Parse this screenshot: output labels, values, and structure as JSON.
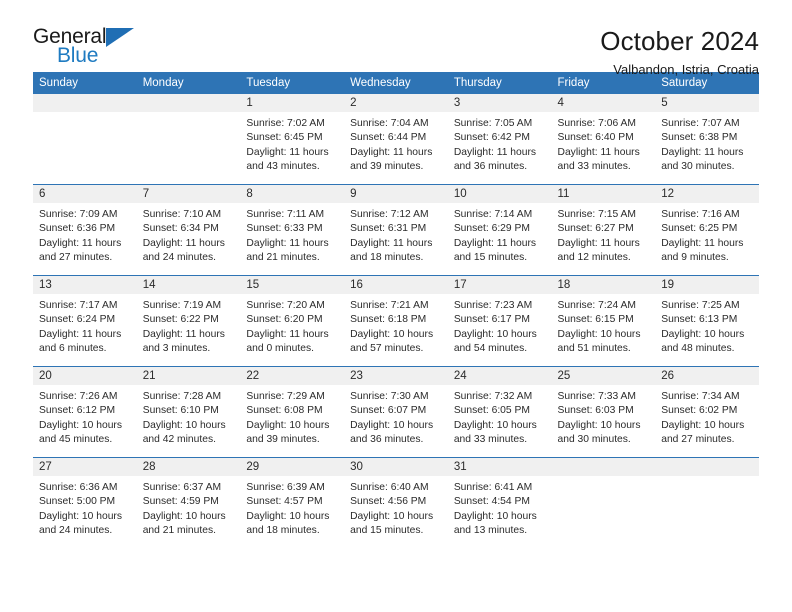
{
  "brand": {
    "name_part1": "General",
    "name_part2": "Blue",
    "accent_color": "#1f7bc1"
  },
  "header": {
    "title": "October 2024",
    "location": "Valbandon, Istria, Croatia"
  },
  "theme": {
    "header_blue": "#2e74b5",
    "band_gray": "#f0f0f0"
  },
  "weekdays": [
    "Sunday",
    "Monday",
    "Tuesday",
    "Wednesday",
    "Thursday",
    "Friday",
    "Saturday"
  ],
  "weeks": [
    [
      {
        "day": "",
        "lines": []
      },
      {
        "day": "",
        "lines": []
      },
      {
        "day": "1",
        "lines": [
          "Sunrise: 7:02 AM",
          "Sunset: 6:45 PM",
          "Daylight: 11 hours",
          "and 43 minutes."
        ]
      },
      {
        "day": "2",
        "lines": [
          "Sunrise: 7:04 AM",
          "Sunset: 6:44 PM",
          "Daylight: 11 hours",
          "and 39 minutes."
        ]
      },
      {
        "day": "3",
        "lines": [
          "Sunrise: 7:05 AM",
          "Sunset: 6:42 PM",
          "Daylight: 11 hours",
          "and 36 minutes."
        ]
      },
      {
        "day": "4",
        "lines": [
          "Sunrise: 7:06 AM",
          "Sunset: 6:40 PM",
          "Daylight: 11 hours",
          "and 33 minutes."
        ]
      },
      {
        "day": "5",
        "lines": [
          "Sunrise: 7:07 AM",
          "Sunset: 6:38 PM",
          "Daylight: 11 hours",
          "and 30 minutes."
        ]
      }
    ],
    [
      {
        "day": "6",
        "lines": [
          "Sunrise: 7:09 AM",
          "Sunset: 6:36 PM",
          "Daylight: 11 hours",
          "and 27 minutes."
        ]
      },
      {
        "day": "7",
        "lines": [
          "Sunrise: 7:10 AM",
          "Sunset: 6:34 PM",
          "Daylight: 11 hours",
          "and 24 minutes."
        ]
      },
      {
        "day": "8",
        "lines": [
          "Sunrise: 7:11 AM",
          "Sunset: 6:33 PM",
          "Daylight: 11 hours",
          "and 21 minutes."
        ]
      },
      {
        "day": "9",
        "lines": [
          "Sunrise: 7:12 AM",
          "Sunset: 6:31 PM",
          "Daylight: 11 hours",
          "and 18 minutes."
        ]
      },
      {
        "day": "10",
        "lines": [
          "Sunrise: 7:14 AM",
          "Sunset: 6:29 PM",
          "Daylight: 11 hours",
          "and 15 minutes."
        ]
      },
      {
        "day": "11",
        "lines": [
          "Sunrise: 7:15 AM",
          "Sunset: 6:27 PM",
          "Daylight: 11 hours",
          "and 12 minutes."
        ]
      },
      {
        "day": "12",
        "lines": [
          "Sunrise: 7:16 AM",
          "Sunset: 6:25 PM",
          "Daylight: 11 hours",
          "and 9 minutes."
        ]
      }
    ],
    [
      {
        "day": "13",
        "lines": [
          "Sunrise: 7:17 AM",
          "Sunset: 6:24 PM",
          "Daylight: 11 hours",
          "and 6 minutes."
        ]
      },
      {
        "day": "14",
        "lines": [
          "Sunrise: 7:19 AM",
          "Sunset: 6:22 PM",
          "Daylight: 11 hours",
          "and 3 minutes."
        ]
      },
      {
        "day": "15",
        "lines": [
          "Sunrise: 7:20 AM",
          "Sunset: 6:20 PM",
          "Daylight: 11 hours",
          "and 0 minutes."
        ]
      },
      {
        "day": "16",
        "lines": [
          "Sunrise: 7:21 AM",
          "Sunset: 6:18 PM",
          "Daylight: 10 hours",
          "and 57 minutes."
        ]
      },
      {
        "day": "17",
        "lines": [
          "Sunrise: 7:23 AM",
          "Sunset: 6:17 PM",
          "Daylight: 10 hours",
          "and 54 minutes."
        ]
      },
      {
        "day": "18",
        "lines": [
          "Sunrise: 7:24 AM",
          "Sunset: 6:15 PM",
          "Daylight: 10 hours",
          "and 51 minutes."
        ]
      },
      {
        "day": "19",
        "lines": [
          "Sunrise: 7:25 AM",
          "Sunset: 6:13 PM",
          "Daylight: 10 hours",
          "and 48 minutes."
        ]
      }
    ],
    [
      {
        "day": "20",
        "lines": [
          "Sunrise: 7:26 AM",
          "Sunset: 6:12 PM",
          "Daylight: 10 hours",
          "and 45 minutes."
        ]
      },
      {
        "day": "21",
        "lines": [
          "Sunrise: 7:28 AM",
          "Sunset: 6:10 PM",
          "Daylight: 10 hours",
          "and 42 minutes."
        ]
      },
      {
        "day": "22",
        "lines": [
          "Sunrise: 7:29 AM",
          "Sunset: 6:08 PM",
          "Daylight: 10 hours",
          "and 39 minutes."
        ]
      },
      {
        "day": "23",
        "lines": [
          "Sunrise: 7:30 AM",
          "Sunset: 6:07 PM",
          "Daylight: 10 hours",
          "and 36 minutes."
        ]
      },
      {
        "day": "24",
        "lines": [
          "Sunrise: 7:32 AM",
          "Sunset: 6:05 PM",
          "Daylight: 10 hours",
          "and 33 minutes."
        ]
      },
      {
        "day": "25",
        "lines": [
          "Sunrise: 7:33 AM",
          "Sunset: 6:03 PM",
          "Daylight: 10 hours",
          "and 30 minutes."
        ]
      },
      {
        "day": "26",
        "lines": [
          "Sunrise: 7:34 AM",
          "Sunset: 6:02 PM",
          "Daylight: 10 hours",
          "and 27 minutes."
        ]
      }
    ],
    [
      {
        "day": "27",
        "lines": [
          "Sunrise: 6:36 AM",
          "Sunset: 5:00 PM",
          "Daylight: 10 hours",
          "and 24 minutes."
        ]
      },
      {
        "day": "28",
        "lines": [
          "Sunrise: 6:37 AM",
          "Sunset: 4:59 PM",
          "Daylight: 10 hours",
          "and 21 minutes."
        ]
      },
      {
        "day": "29",
        "lines": [
          "Sunrise: 6:39 AM",
          "Sunset: 4:57 PM",
          "Daylight: 10 hours",
          "and 18 minutes."
        ]
      },
      {
        "day": "30",
        "lines": [
          "Sunrise: 6:40 AM",
          "Sunset: 4:56 PM",
          "Daylight: 10 hours",
          "and 15 minutes."
        ]
      },
      {
        "day": "31",
        "lines": [
          "Sunrise: 6:41 AM",
          "Sunset: 4:54 PM",
          "Daylight: 10 hours",
          "and 13 minutes."
        ]
      },
      {
        "day": "",
        "lines": []
      },
      {
        "day": "",
        "lines": []
      }
    ]
  ]
}
